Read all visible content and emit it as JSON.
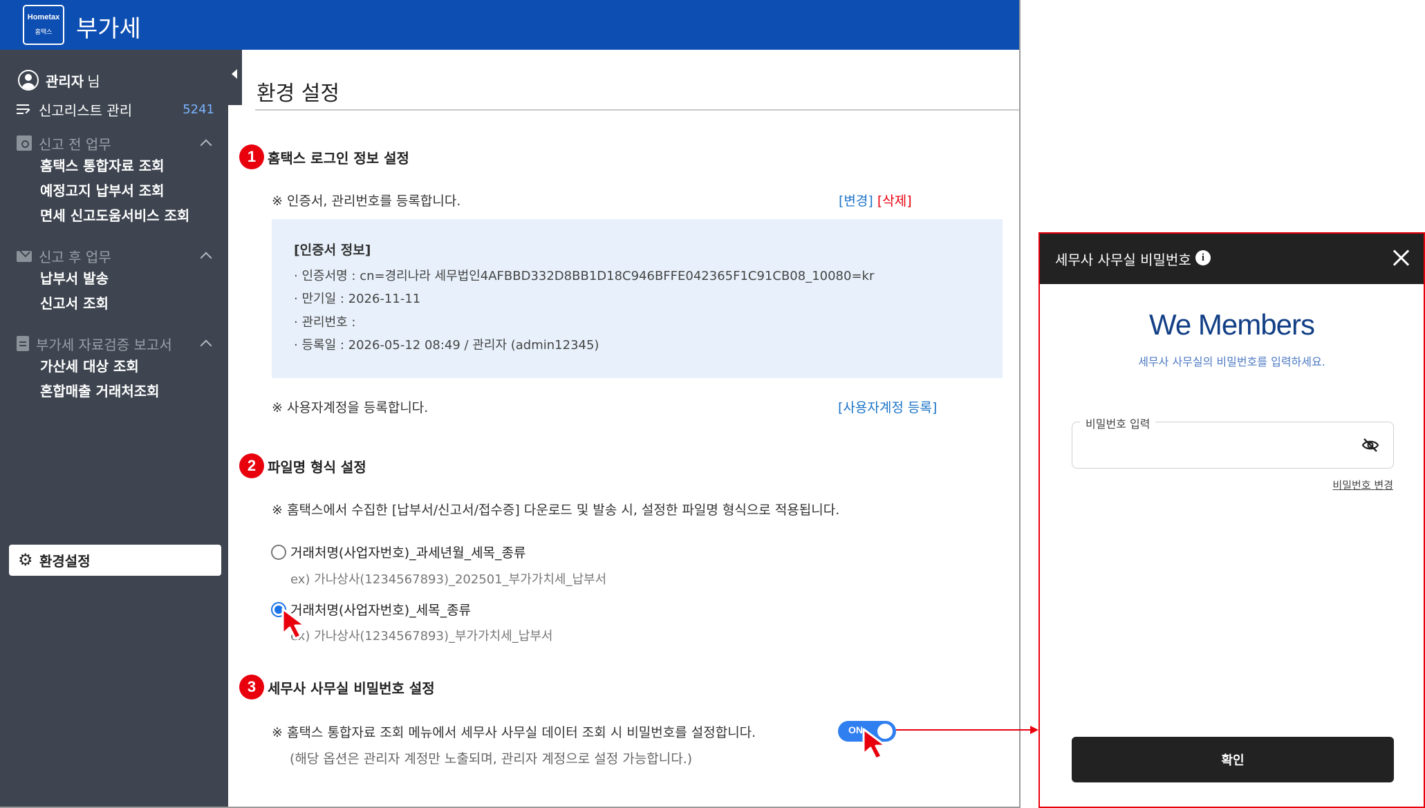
{
  "app": {
    "logo_text": "Hometax",
    "logo_sub": "홈택스",
    "title": "부가세"
  },
  "sidebar": {
    "user_name": "관리자",
    "user_suffix": "님",
    "report_list": {
      "label": "신고리스트 관리",
      "count": "5241"
    },
    "sections": [
      {
        "label": "신고 전 업무",
        "items": [
          "홈택스 통합자료 조회",
          "예정고지 납부서 조회",
          "면세 신고도움서비스 조회"
        ]
      },
      {
        "label": "신고 후 업무",
        "items": [
          "납부서 발송",
          "신고서 조회"
        ]
      },
      {
        "label": "부가세 자료검증 보고서",
        "items": [
          "가산세 대상 조회",
          "혼합매출 거래처조회"
        ]
      }
    ],
    "settings_label": "환경설정"
  },
  "main": {
    "page_title": "환경 설정",
    "step1": {
      "num": "1",
      "title": "홈택스 로그인 정보 설정",
      "note": "※ 인증서, 관리번호를 등록합니다.",
      "change_link": "[변경]",
      "delete_link": "[삭제]",
      "cert": {
        "heading": "[인증서 정보]",
        "lines": [
          "· 인증서명 : cn=경리나라 세무법인4AFBBD332D8BB1D18C946BFFE042365F1C91CB08_10080=kr",
          "· 만기일 : 2026-11-11",
          "· 관리번호 :",
          "· 등록일 : 2026-05-12 08:49 / 관리자 (admin12345)"
        ]
      },
      "user_note": "※ 사용자계정을 등록합니다.",
      "user_link": "[사용자계정 등록]"
    },
    "step2": {
      "num": "2",
      "title": "파일명 형식 설정",
      "note": "※ 홈택스에서 수집한 [납부서/신고서/접수증] 다운로드 및 발송 시, 설정한 파일명 형식으로 적용됩니다.",
      "options": [
        {
          "label": "거래처명(사업자번호)_과세년월_세목_종류",
          "example": "ex) 가나상사(1234567893)_202501_부가가치세_납부서",
          "selected": false
        },
        {
          "label": "거래처명(사업자번호)_세목_종류",
          "example": "ex) 가나상사(1234567893)_부가가치세_납부서",
          "selected": true
        }
      ]
    },
    "step3": {
      "num": "3",
      "title": "세무사 사무실 비밀번호 설정",
      "note": "※ 홈택스 통합자료 조회 메뉴에서 세무사 사무실 데이터 조회 시 비밀번호를 설정합니다.",
      "subnote": "(해당 옵션은 관리자 계정만 노출되며, 관리자 계정으로 설정 가능합니다.)",
      "toggle_label": "ON",
      "toggle_on": true
    }
  },
  "modal": {
    "title": "세무사 사무실 비밀번호",
    "brand": "We Members",
    "subtitle": "세무사 사무실의 비밀번호를 입력하세요.",
    "field_label": "비밀번호 입력",
    "field_value": "",
    "change_link": "비밀번호 변경",
    "confirm": "확인"
  },
  "colors": {
    "header_blue": "#0d4eb2",
    "sidebar_dark": "#3e4550",
    "badge_red": "#e8000d",
    "toggle_blue": "#2f7ff0",
    "cert_bg": "#e8f1fb",
    "brand_navy": "#123f86"
  }
}
